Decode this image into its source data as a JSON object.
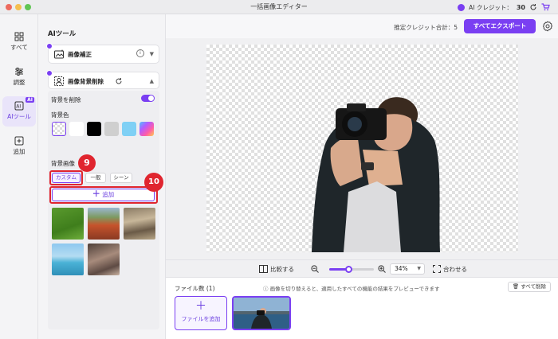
{
  "app": {
    "title": "一括画像エディター"
  },
  "credits": {
    "label": "AI クレジット：",
    "count": "30"
  },
  "nav": [
    {
      "label": "すべて",
      "icon": "grid-icon"
    },
    {
      "label": "調整",
      "icon": "sliders-icon"
    },
    {
      "label": "AIツール",
      "icon": "ai-icon",
      "badge": "AI"
    },
    {
      "label": "追加",
      "icon": "plus-square-icon"
    }
  ],
  "panel": {
    "title": "AIツール",
    "tools": [
      {
        "name": "画像補正",
        "icon": "enhance-icon"
      },
      {
        "name": "画像背景削除",
        "icon": "remove-bg-icon"
      }
    ],
    "remove_bg_label": "背景を削除",
    "bg_color_label": "背景色",
    "bg_image_label": "背景画像",
    "tabs": [
      "カスタム",
      "一般",
      "シーン"
    ],
    "add_button": "追加",
    "swatches": [
      "transparent",
      "#ffffff",
      "#000000",
      "#cfcfcf",
      "#7fd0f5",
      "gradient"
    ]
  },
  "callouts": [
    "9",
    "10"
  ],
  "topbar": {
    "total_credit": "推定クレジット合計：5",
    "export": "すべてエクスポート"
  },
  "zoombar": {
    "compare": "比較する",
    "zoom": "34%",
    "fit": "合わせる",
    "zoom_level_fraction": 0.34
  },
  "filestrip": {
    "title": "ファイル数 (1)",
    "note": "画像を切り替えると、適用したすべての機能の結果をプレビューできます",
    "delete_all": "すべて削除",
    "add_file": "ファイルを追加"
  }
}
